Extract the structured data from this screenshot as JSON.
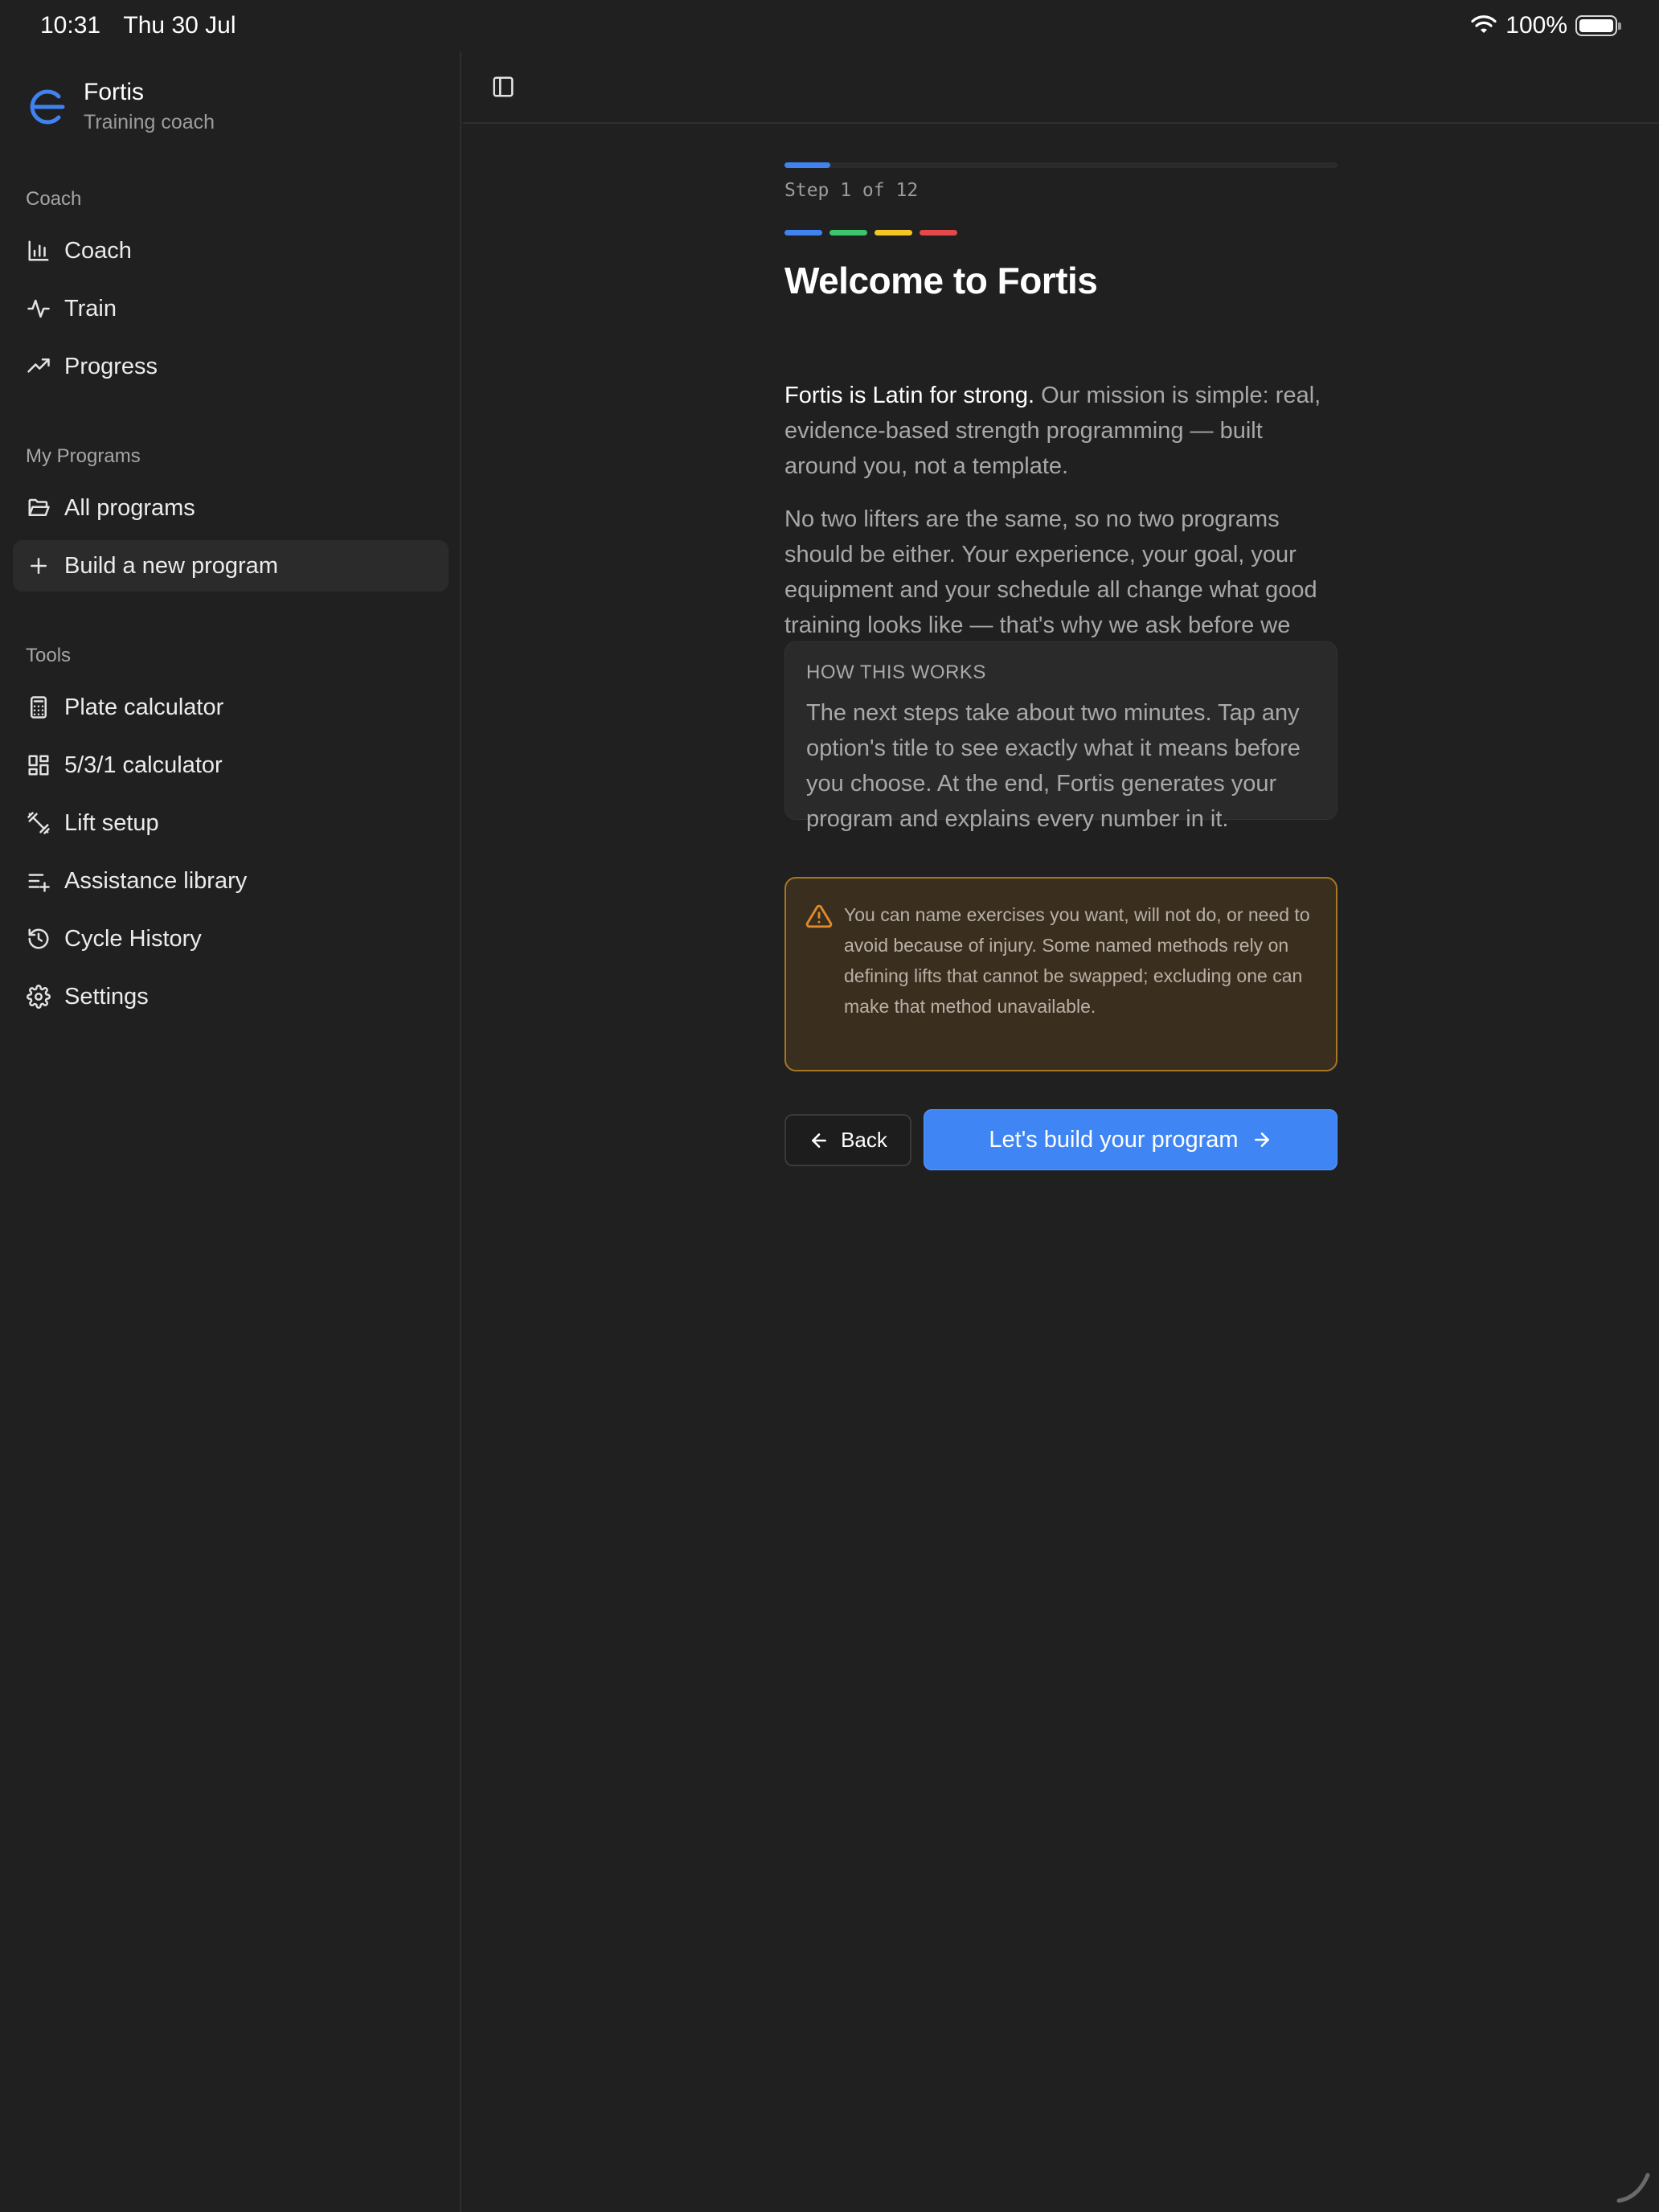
{
  "status_bar": {
    "time": "10:31",
    "date": "Thu 30 Jul",
    "battery": "100%"
  },
  "brand": {
    "name": "Fortis",
    "subtitle": "Training coach"
  },
  "sidebar": {
    "sections": [
      {
        "label": "Coach",
        "items": [
          {
            "label": "Coach",
            "icon": "bar-chart-icon"
          },
          {
            "label": "Train",
            "icon": "activity-icon"
          },
          {
            "label": "Progress",
            "icon": "trending-up-icon"
          }
        ]
      },
      {
        "label": "My Programs",
        "items": [
          {
            "label": "All programs",
            "icon": "folder-open-icon"
          },
          {
            "label": "Build a new program",
            "icon": "plus-icon",
            "active": true
          }
        ]
      },
      {
        "label": "Tools",
        "items": [
          {
            "label": "Plate calculator",
            "icon": "calculator-icon"
          },
          {
            "label": "5/3/1 calculator",
            "icon": "dashboard-icon"
          },
          {
            "label": "Lift setup",
            "icon": "dumbbell-icon"
          },
          {
            "label": "Assistance library",
            "icon": "list-plus-icon"
          },
          {
            "label": "Cycle History",
            "icon": "history-icon"
          },
          {
            "label": "Settings",
            "icon": "gear-icon"
          }
        ]
      }
    ]
  },
  "wizard": {
    "progress_fraction": 0.0833,
    "step_text": "Step 1 of 12",
    "dot_colors": [
      "#3f82f0",
      "#3ec46d",
      "#f5c528",
      "#e54848"
    ],
    "title": "Welcome to Fortis",
    "intro_strong": "Fortis is Latin for strong.",
    "intro_rest": " Our mission is simple: real, evidence-based strength programming — built around you, not a template.",
    "para2": "No two lifters are the same, so no two programs should be either. Your experience, your goal, your equipment and your schedule all change what good training looks like — that's why we ask before we build.",
    "how_label": "HOW THIS WORKS",
    "how_body": "The next steps take about two minutes. Tap any option's title to see exactly what it means before you choose. At the end, Fortis generates your program and explains every number in it.",
    "warning": "You can name exercises you want, will not do, or need to avoid because of injury. Some named methods rely on defining lifts that cannot be swapped; excluding one can make that method unavailable.",
    "back_label": "Back",
    "next_label": "Let's build your program"
  },
  "colors": {
    "accent": "#3f86f4",
    "warning_border": "#a67624",
    "warning_icon": "#e08a2a"
  }
}
